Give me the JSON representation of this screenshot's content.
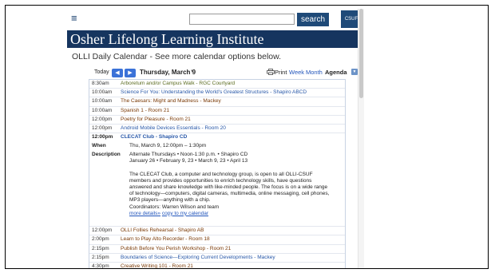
{
  "header": {
    "menu_icon": "hamburger-icon",
    "search_button": "search",
    "search_value": "",
    "badge": "CSUF"
  },
  "site_title": "Osher Lifelong Learning Institute",
  "page_heading": "OLLI Daily Calendar - See more calendar options below.",
  "toolbar": {
    "today": "Today",
    "prev": "◀",
    "next": "▶",
    "date": "Thursday, March 9",
    "print": "Print",
    "week": "Week",
    "month": "Month",
    "agenda": "Agenda"
  },
  "events_before": [
    {
      "time": "8:30am",
      "title": "Arboretum and/or Campus Walk - RGC Courtyard",
      "color": "#5b6b1f"
    },
    {
      "time": "10:00am",
      "title": "Science For You: Understanding the World's Greatest Structures - Shapiro ABCD",
      "color": "#2757a8"
    },
    {
      "time": "10:00am",
      "title": "The Caesars: Might and Madness - Mackey",
      "color": "#7a3a07"
    },
    {
      "time": "10:00am",
      "title": "Spanish 1 - Room 21",
      "color": "#7a3a07"
    },
    {
      "time": "12:00pm",
      "title": "Poetry for Pleasure - Room 21",
      "color": "#7a3a07"
    },
    {
      "time": "12:00pm",
      "title": "Android Mobile Devices Essentials - Room 20",
      "color": "#2757a8"
    }
  ],
  "expanded_event": {
    "time": "12:00pm",
    "title": "CLECAT Club - Shapiro CD",
    "when_label": "When",
    "when_value": "Thu, March 9, 12:00pm – 1:30pm",
    "description_label": "Description",
    "desc_line1": "Alternate Thursdays • Noon-1:30 p.m. • Shapiro CD",
    "desc_line2": "January 26 • February 9, 23 • March 9, 23 • April 13",
    "desc_para1": "The CLECAT Club, a computer and technology group, is open to all OLLI-CSUF",
    "desc_para2": "members and provides opportunities to enrich technology skills, have questions",
    "desc_para3": "answered and share knowledge with like-minded people. The focus is on a wide range",
    "desc_para4": "of technology—computers, digital cameras, multimedia, online messaging, cell phones,",
    "desc_para5": "MP3 players—anything with a chip.",
    "desc_para6": "Coordinators: Warren Wilson and team",
    "more_details": "more details»",
    "copy_link": "copy to my calendar"
  },
  "events_after": [
    {
      "time": "12:00pm",
      "title": "OLLI Follies Rehearsal - Shapiro AB",
      "color": "#7a3a07"
    },
    {
      "time": "2:00pm",
      "title": "Learn to Play Alto Recorder - Room 18",
      "color": "#7a3a07"
    },
    {
      "time": "2:15pm",
      "title": "Publish Before You Perish Workshop - Room 21",
      "color": "#7a3a07"
    },
    {
      "time": "2:15pm",
      "title": "Boundaries of Science—Exploring Current Developments - Mackey",
      "color": "#2757a8"
    },
    {
      "time": "4:30pm",
      "title": "Creative Writing 101 - Room 21",
      "color": "#7a3a07"
    }
  ]
}
